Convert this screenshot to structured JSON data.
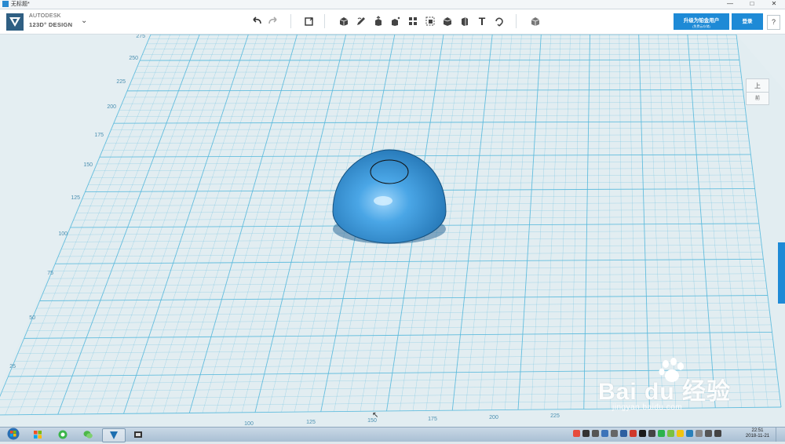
{
  "window": {
    "title": "无标题*",
    "minimize": "—",
    "maximize": "□",
    "close": "✕"
  },
  "app": {
    "brand_line1": "AUTODESK",
    "brand_line2": "123D° DESIGN",
    "brand_menu_icon": "chevron-down-icon"
  },
  "toolbar": {
    "tools": [
      {
        "name": "undo-button",
        "icon": "undo-icon"
      },
      {
        "name": "redo-button",
        "icon": "redo-icon"
      },
      {
        "name": "transform-button",
        "icon": "transform-icon"
      },
      {
        "name": "primitives-button",
        "icon": "box-icon"
      },
      {
        "name": "sketch-button",
        "icon": "pencil-icon"
      },
      {
        "name": "construct-button",
        "icon": "extrude-icon"
      },
      {
        "name": "modify-button",
        "icon": "modify-icon"
      },
      {
        "name": "pattern-button",
        "icon": "pattern-icon"
      },
      {
        "name": "grouping-button",
        "icon": "group-icon"
      },
      {
        "name": "combine-button",
        "icon": "combine-icon"
      },
      {
        "name": "measure-button",
        "icon": "measure-icon"
      },
      {
        "name": "text-button",
        "icon": "text-icon"
      },
      {
        "name": "snap-button",
        "icon": "snap-icon"
      },
      {
        "name": "material-button",
        "icon": "material-icon"
      }
    ],
    "text_tool_label": "T"
  },
  "account": {
    "upgrade_label": "升级为铂金用户",
    "upgrade_sub": "(免费云存储)",
    "login_label": "登录",
    "help_label": "?"
  },
  "viewcube": {
    "top": "上",
    "front": "前"
  },
  "grid": {
    "y_labels": [
      "275",
      "250",
      "225",
      "200",
      "175",
      "150",
      "125",
      "100",
      "75",
      "50",
      "25"
    ],
    "x_labels": [
      "100",
      "125",
      "150",
      "175",
      "200",
      "225"
    ]
  },
  "colors": {
    "accent": "#1e8ad6",
    "grid_line": "#4fb3d6",
    "shape": "#3d9ad6"
  },
  "watermark": {
    "text": "Bai du 经验",
    "sub": "jingyan.baidu.com"
  },
  "taskbar": {
    "time": "22:51",
    "date": "2018-11-21"
  }
}
